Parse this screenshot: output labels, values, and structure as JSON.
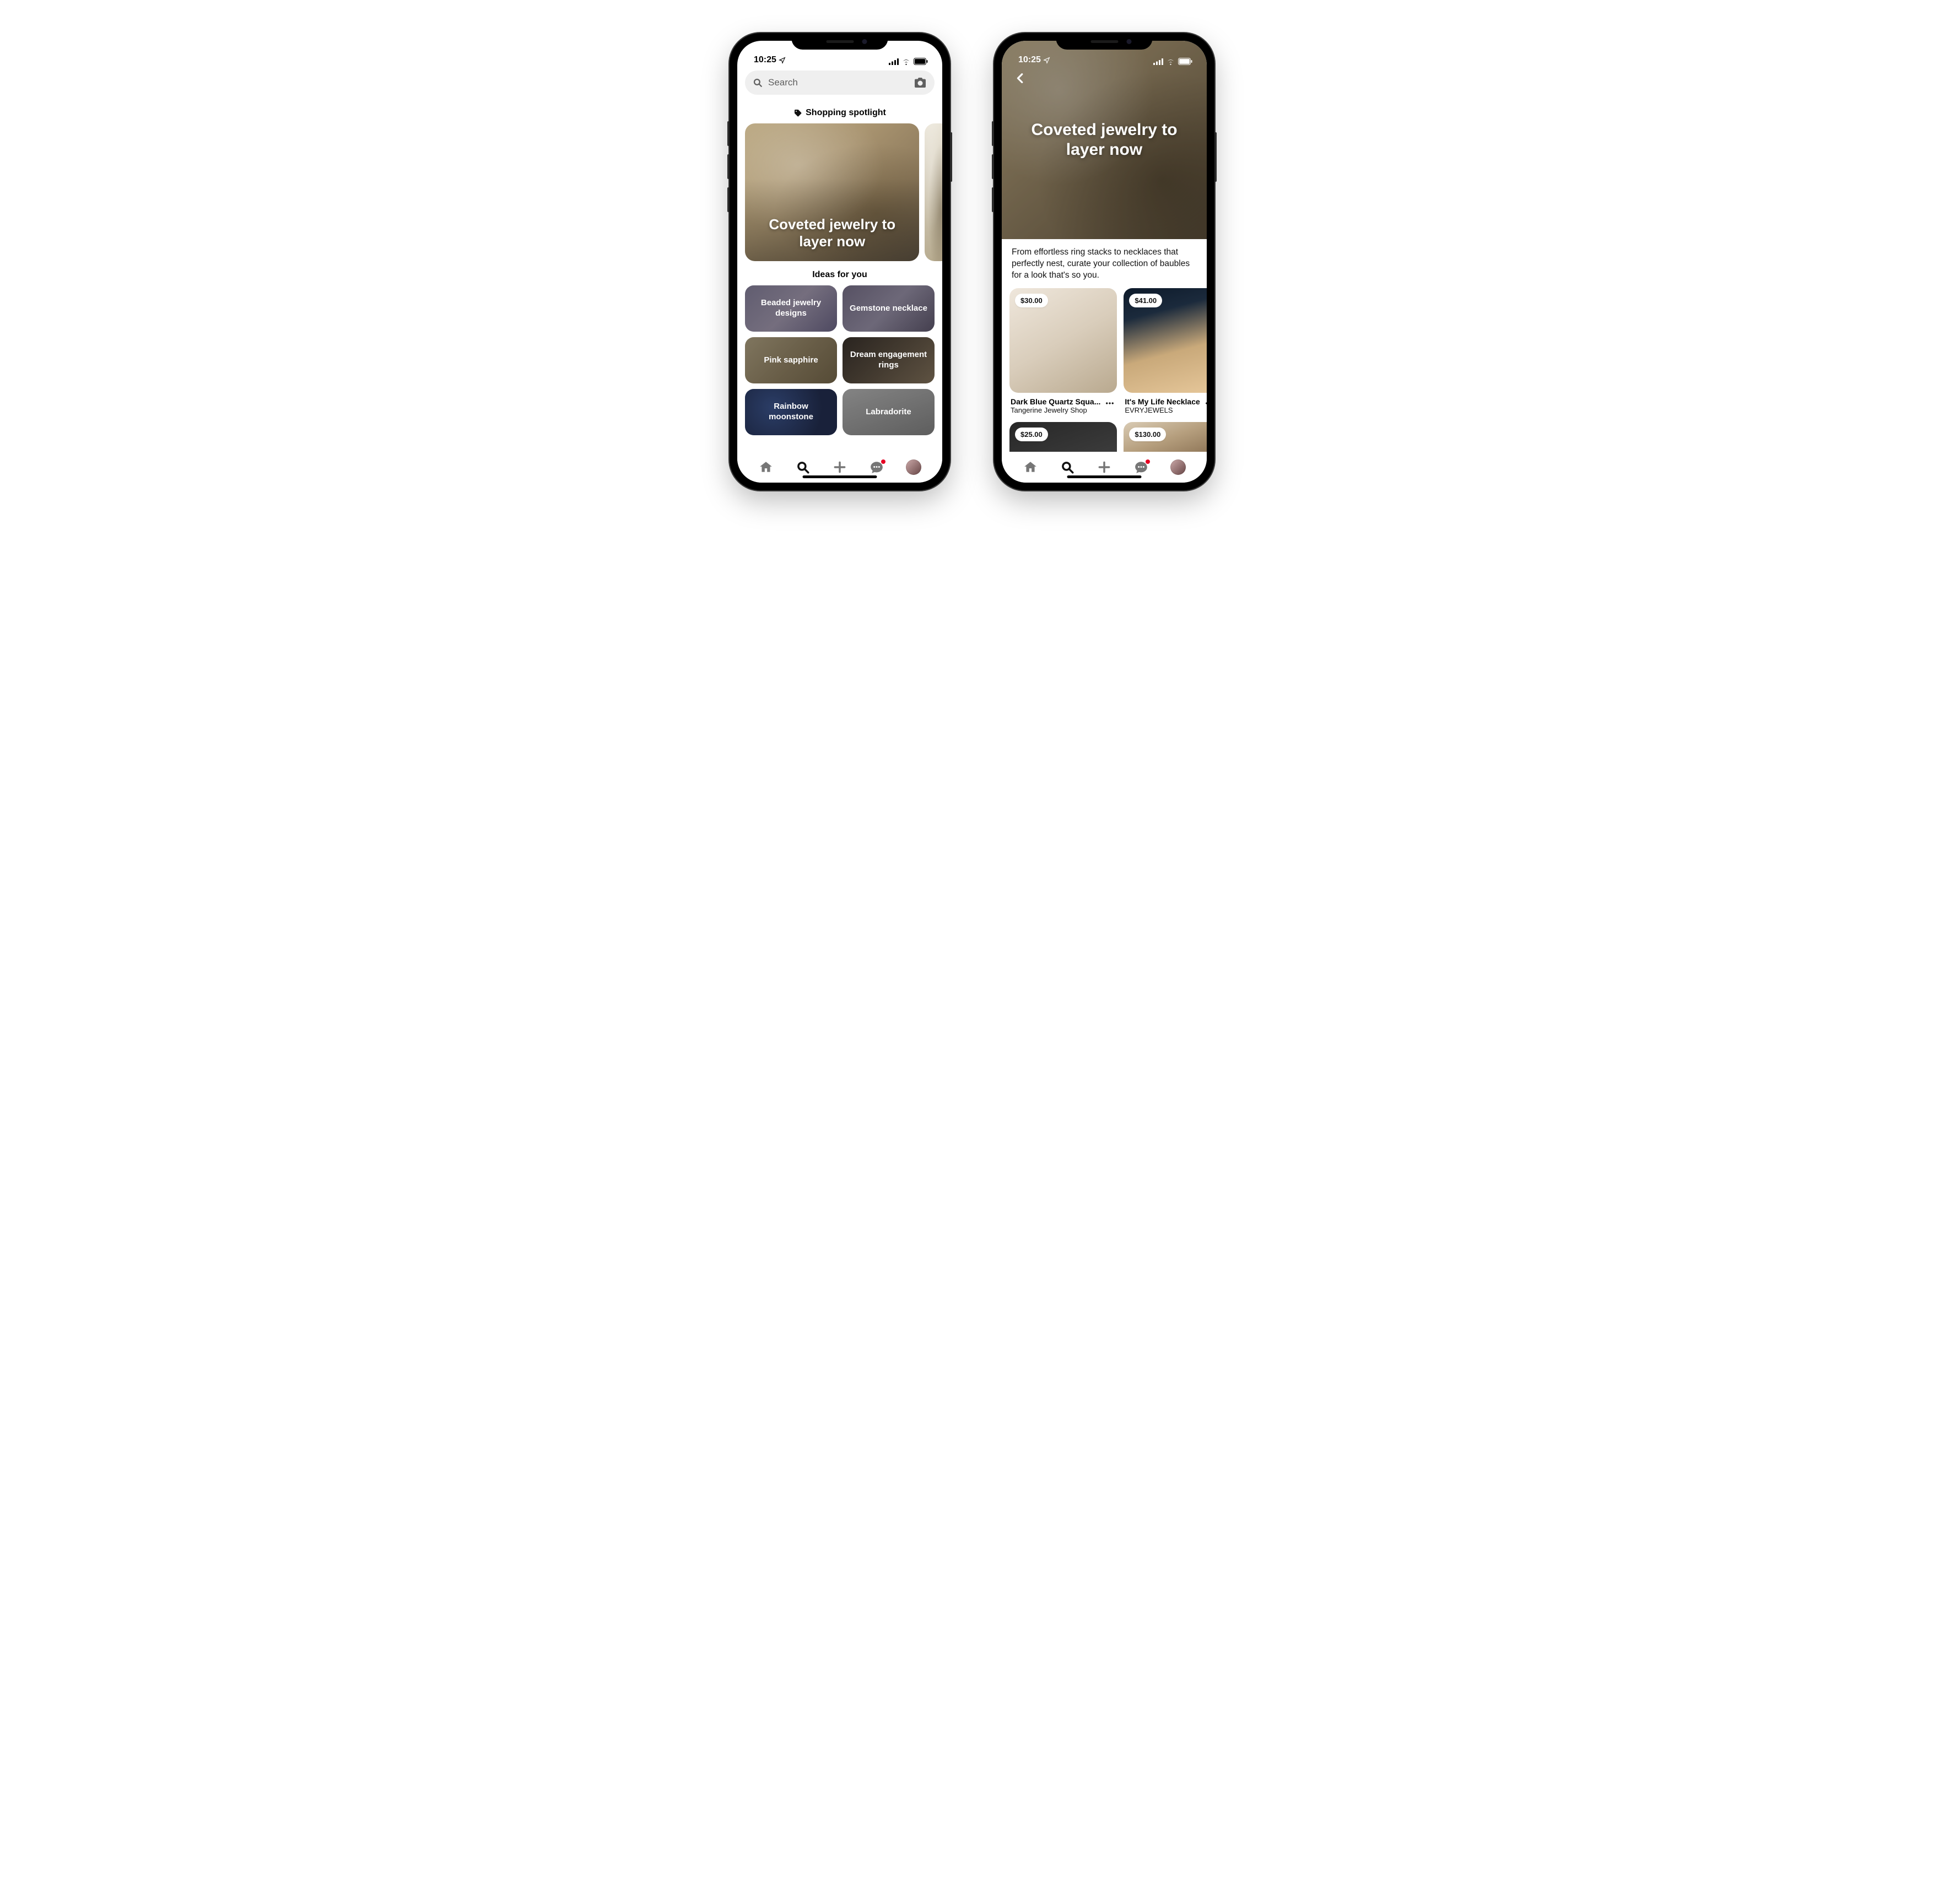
{
  "status": {
    "time": "10:25"
  },
  "phone1": {
    "search": {
      "placeholder": "Search"
    },
    "spotlight_header": "Shopping spotlight",
    "hero_title": "Coveted jewelry to layer now",
    "ideas_header": "Ideas for you",
    "ideas": [
      {
        "label": "Beaded jewelry designs"
      },
      {
        "label": "Gemstone necklace"
      },
      {
        "label": "Pink sapphire"
      },
      {
        "label": "Dream engagement rings"
      },
      {
        "label": "Rainbow moonstone"
      },
      {
        "label": "Labradorite"
      }
    ]
  },
  "phone2": {
    "hero_title": "Coveted jewelry to layer now",
    "description": "From effortless ring stacks to necklaces that perfectly nest, curate your collection of baubles for a look that's so you.",
    "products": [
      {
        "price": "$30.00",
        "title": "Dark Blue Quartz Squa...",
        "seller": "Tangerine Jewelry Shop"
      },
      {
        "price": "$41.00",
        "title": "It's My Life Necklace",
        "seller": "EVRYJEWELS"
      },
      {
        "price": "$25.00",
        "title": "",
        "seller": ""
      },
      {
        "price": "$130.00",
        "title": "",
        "seller": ""
      }
    ]
  }
}
